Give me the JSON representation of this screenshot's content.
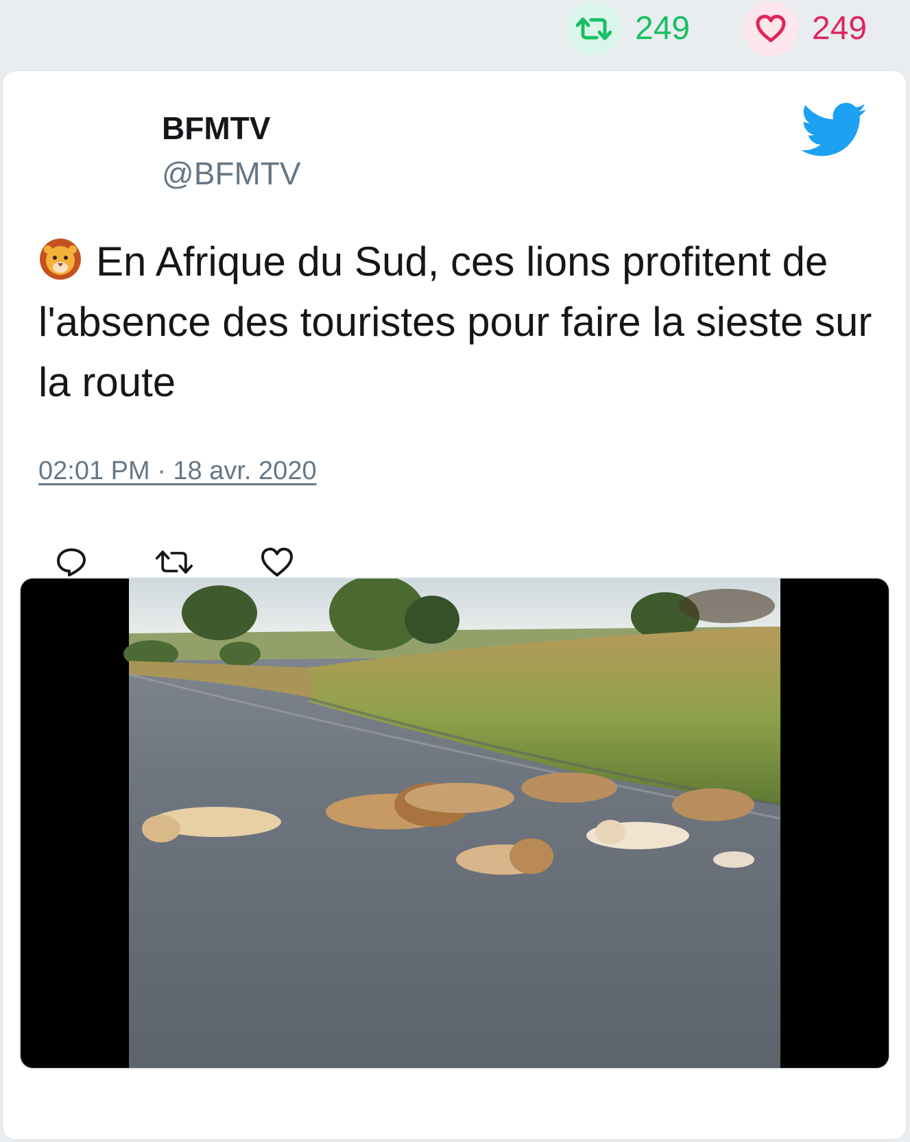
{
  "engagement": {
    "retweet_icon": "retweet-icon",
    "retweet_count": "249",
    "like_icon": "heart-icon",
    "like_count": "249",
    "retweet_color": "#17bf63",
    "like_color": "#e0245e"
  },
  "tweet": {
    "display_name": "BFMTV",
    "handle": "@BFMTV",
    "emoji": "lion-face-emoji",
    "text": "En Afrique du Sud, ces lions profitent de l'absence des touristes pour faire la sieste sur la route",
    "timestamp": "02:01 PM · 18 avr. 2020",
    "brand_icon": "twitter-bird-icon",
    "brand_color": "#1da1f2"
  },
  "actions": [
    {
      "icon": "reply-icon"
    },
    {
      "icon": "retweet-icon"
    },
    {
      "icon": "like-icon"
    }
  ],
  "media": {
    "type": "photo",
    "icon": "lions-on-road-photo"
  }
}
